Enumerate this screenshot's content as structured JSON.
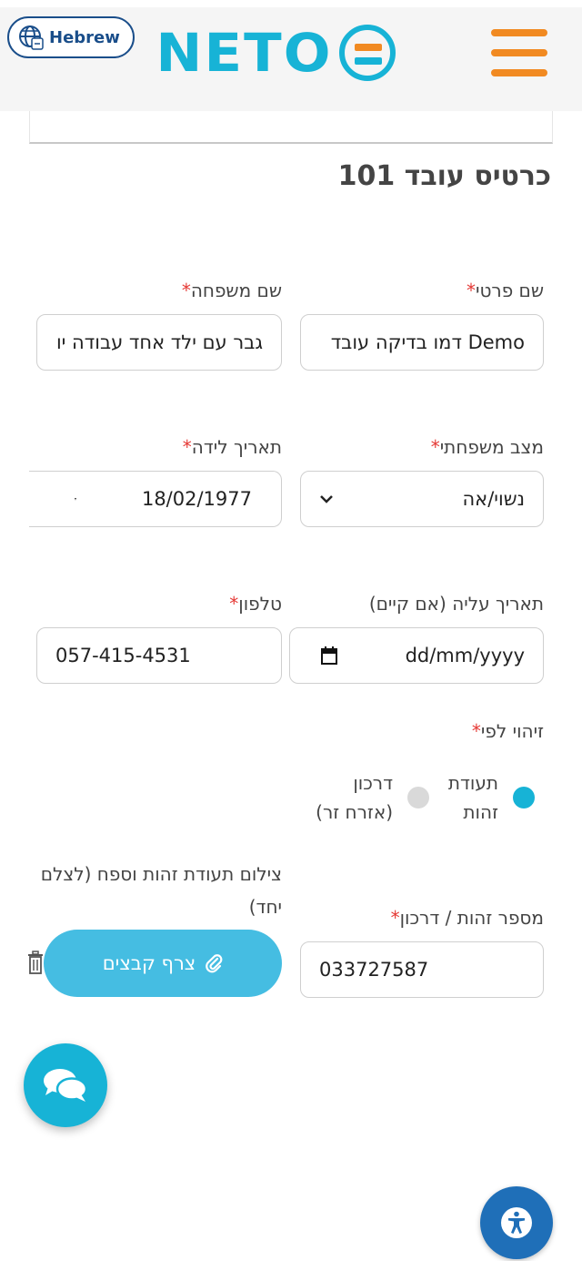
{
  "header": {
    "language_label": "Hebrew",
    "logo_text": "NETO"
  },
  "page": {
    "title": "כרטיס עובד 101"
  },
  "form": {
    "first_name": {
      "label": "שם פרטי",
      "required": "*",
      "value": "Demo דמו בדיקה עובד"
    },
    "last_name": {
      "label": "שם משפחה",
      "required": "*",
      "value": "גבר עם ילד אחד עבודה יו"
    },
    "marital_status": {
      "label": "מצב משפחתי",
      "required": "*",
      "value": "נשוי/אה"
    },
    "birth_date": {
      "label": "תאריך לידה",
      "required": "*",
      "value": "18/02/1977"
    },
    "aliyah_date": {
      "label": "תאריך עליה (אם קיים)",
      "placeholder": "dd/mm/yyyy"
    },
    "phone": {
      "label": "טלפון",
      "required": "*",
      "value": "057-415-4531"
    },
    "id_by": {
      "label": "זיהוי לפי",
      "required": "*",
      "options": [
        {
          "line1": "תעודת",
          "line2": "זהות",
          "selected": true
        },
        {
          "line1": "דרכון",
          "line2": "(אזרח זר)",
          "selected": false
        }
      ]
    },
    "id_number": {
      "label": "מספר זהות / דרכון",
      "required": "*",
      "value": "033727587"
    },
    "id_photo": {
      "label_line1": "צילום תעודת זהות וספח (לצלם",
      "label_line2": "יחד)",
      "button_label": "צרף קבצים"
    }
  },
  "colors": {
    "brand_blue": "#17b3d6",
    "brand_orange": "#f18a22",
    "attach_button": "#45bde2",
    "accessibility": "#1f6fb8",
    "required": "#e53935"
  },
  "icons": [
    "globe-icon",
    "hamburger-icon",
    "chevron-down-icon",
    "calendar-icon",
    "paperclip-icon",
    "trash-icon",
    "chat-icon",
    "accessibility-icon"
  ]
}
